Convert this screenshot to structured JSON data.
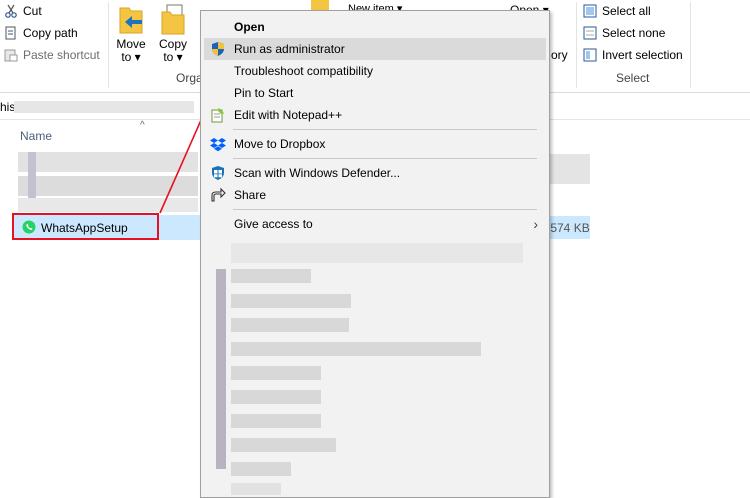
{
  "ribbon": {
    "clipboard": {
      "cut": "Cut",
      "copy_path": "Copy path",
      "paste_shortcut": "Paste shortcut"
    },
    "organize": {
      "move_to": [
        "Move",
        "to ▾"
      ],
      "copy_to": [
        "Copy",
        "to ▾"
      ],
      "group_label": "Orga"
    },
    "new": {
      "new_item": "New item ▾"
    },
    "open": {
      "open_label": "Open ▾",
      "history_partial": "ory"
    },
    "select": {
      "select_all": "Select all",
      "select_none": "Select none",
      "invert": "Invert selection",
      "group_label": "Select"
    }
  },
  "address": {
    "partial_text": "his"
  },
  "file_list": {
    "column_name": "Name",
    "selected_file": "WhatsAppSetup",
    "selected_size": ",574 KB"
  },
  "context_menu": {
    "items": [
      {
        "label": "Open",
        "bold": true
      },
      {
        "label": "Run as administrator",
        "highlighted": true
      },
      {
        "label": "Troubleshoot compatibility"
      },
      {
        "label": "Pin to Start"
      },
      {
        "label": "Edit with Notepad++"
      },
      {
        "label": "Move to Dropbox"
      },
      {
        "label": "Scan with Windows Defender..."
      },
      {
        "label": "Share"
      },
      {
        "label": "Give access to",
        "submenu": "›"
      }
    ]
  },
  "colors": {
    "highlight_red": "#e81123",
    "selection_blue": "#cce8ff",
    "whatsapp_green": "#25d366",
    "menu_background": "#f2f2f2"
  }
}
